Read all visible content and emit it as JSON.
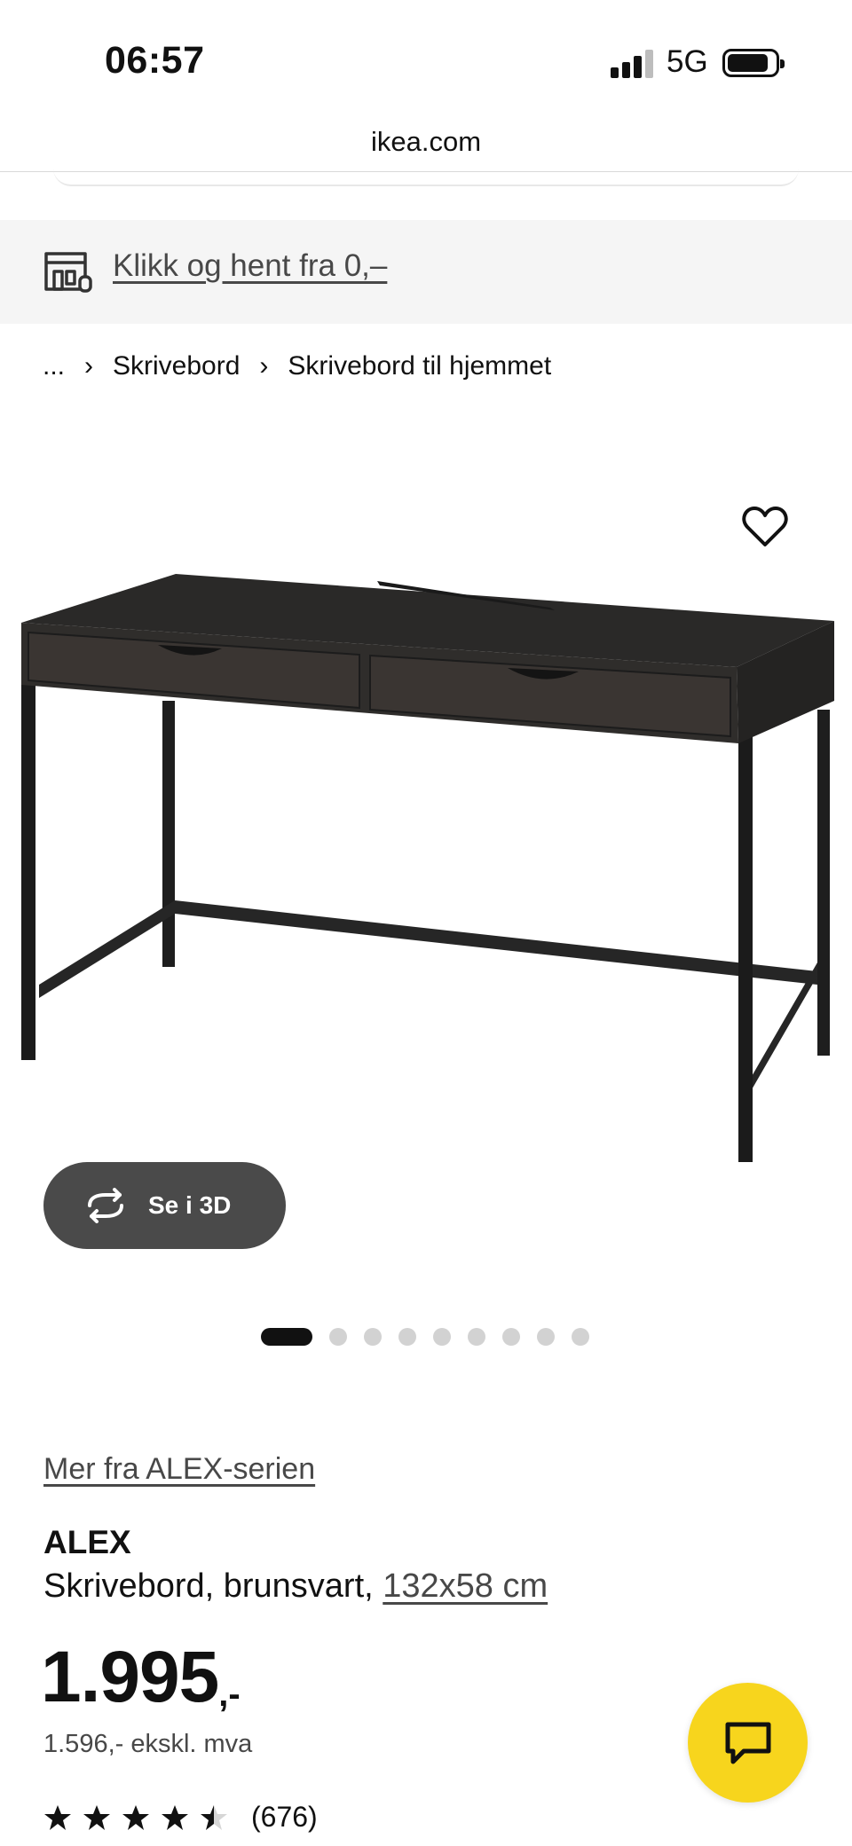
{
  "status_bar": {
    "time": "06:57",
    "network": "5G",
    "icons": [
      "signal-icon",
      "battery-icon"
    ]
  },
  "browser": {
    "url": "ikea.com"
  },
  "banner": {
    "icon": "store-icon",
    "link_text": "Klikk og hent fra 0,–"
  },
  "breadcrumb": {
    "items": [
      "...",
      "Skrivebord",
      "Skrivebord til hjemmet"
    ],
    "separator_icon": "chevron-right-icon"
  },
  "gallery": {
    "favorite_icon": "heart-icon",
    "view_3d_label": "Se i 3D",
    "view_3d_icon": "rotate-icon",
    "image_count": 9,
    "active_index": 0
  },
  "product": {
    "series_link": "Mer fra ALEX-serien",
    "name": "ALEX",
    "description": "Skrivebord, brunsvart, ",
    "size_link": "132x58 cm",
    "price_main": "1.995",
    "price_suffix": ",-",
    "price_ex_vat": "1.596,- ekskl. mva",
    "rating_value": 4.5,
    "rating_count": "(676)"
  },
  "colors": {
    "brand_yellow": "#f7d51d",
    "banner_bg": "#f5f5f5",
    "button_dark": "#4a4a4a",
    "link_gray": "#484848"
  },
  "chat": {
    "icon": "chat-bubble-icon"
  }
}
